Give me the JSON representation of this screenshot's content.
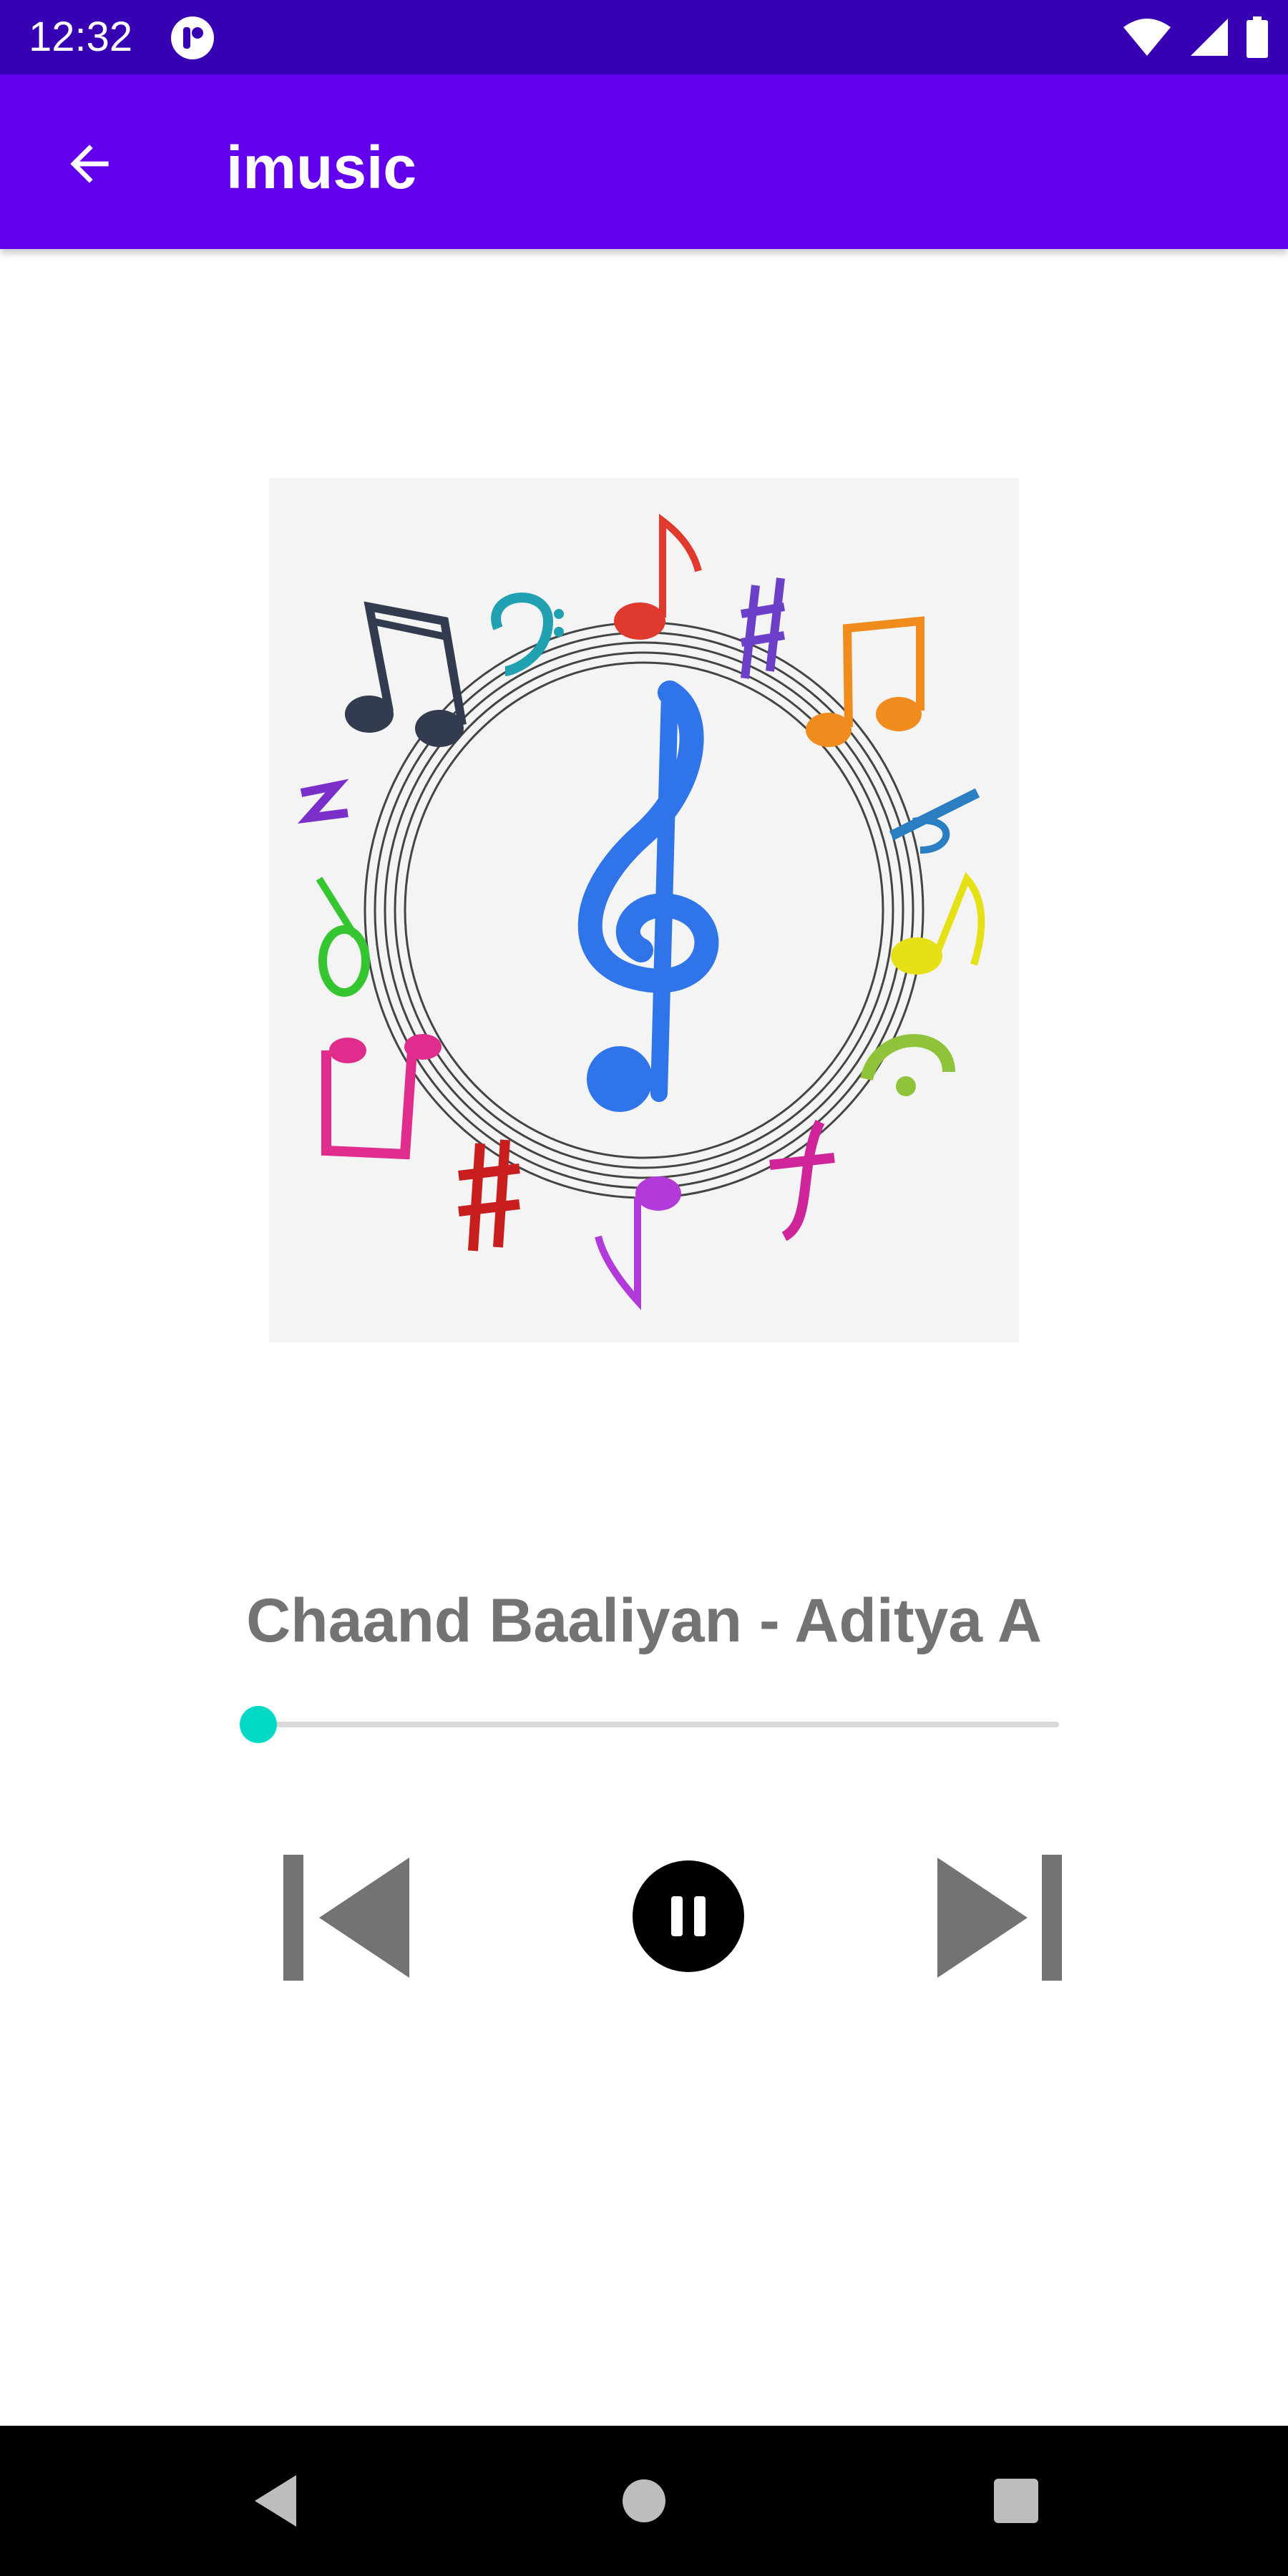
{
  "status_bar": {
    "time": "12:32",
    "icons": [
      "app-notification-icon",
      "wifi-icon",
      "cellular-signal-icon",
      "battery-icon"
    ]
  },
  "app_bar": {
    "title": "imusic",
    "back_icon": "arrow-back-icon",
    "color": "#6200ee",
    "status_color": "#3700b3"
  },
  "player": {
    "album_art": "music-notes-circle-with-treble-clef",
    "song_title": "Chaand Baaliyan - Aditya A",
    "progress": 0.02,
    "accent_color": "#03dac5",
    "controls": {
      "previous_icon": "skip-previous-icon",
      "play_pause_icon": "pause-icon",
      "next_icon": "skip-next-icon"
    }
  },
  "nav_bar": {
    "icons": [
      "nav-back-icon",
      "nav-home-icon",
      "nav-recents-icon"
    ]
  }
}
